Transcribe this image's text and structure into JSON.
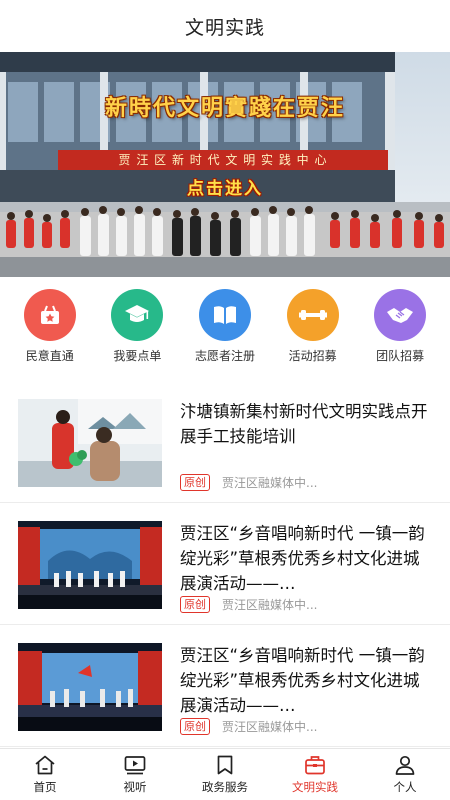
{
  "header": {
    "title": "文明实践"
  },
  "banner": {
    "headline": "新時代文明實踐在贾汪",
    "sign": "贾 汪 区 新 时 代 文 明 实 践 中 心",
    "cta": "点击进入"
  },
  "quick_nav": [
    {
      "label": "民意直通",
      "icon": "basket-star-icon",
      "color": "#f05a4f"
    },
    {
      "label": "我要点单",
      "icon": "graduation-cap-icon",
      "color": "#27b98a"
    },
    {
      "label": "志愿者注册",
      "icon": "open-book-icon",
      "color": "#3d8fe8"
    },
    {
      "label": "活动招募",
      "icon": "dumbbell-icon",
      "color": "#f4a12a"
    },
    {
      "label": "团队招募",
      "icon": "handshake-icon",
      "color": "#9a72e6"
    }
  ],
  "news": [
    {
      "title": "汴塘镇新集村新时代文明实践点开展手工技能培训",
      "tag": "原创",
      "source": "贾汪区融媒体中..."
    },
    {
      "title": "贾汪区“乡音唱响新时代 一镇一韵绽光彩”草根秀优秀乡村文化进城展演活动——…",
      "tag": "原创",
      "source": "贾汪区融媒体中..."
    },
    {
      "title": "贾汪区“乡音唱响新时代 一镇一韵绽光彩”草根秀优秀乡村文化进城展演活动——…",
      "tag": "原创",
      "source": "贾汪区融媒体中..."
    }
  ],
  "tabbar": [
    {
      "label": "首页",
      "icon": "home-icon",
      "active": false
    },
    {
      "label": "视听",
      "icon": "video-play-icon",
      "active": false
    },
    {
      "label": "政务服务",
      "icon": "bookmark-icon",
      "active": false
    },
    {
      "label": "文明实践",
      "icon": "briefcase-icon",
      "active": true
    },
    {
      "label": "个人",
      "icon": "person-icon",
      "active": false
    }
  ],
  "colors": {
    "accent": "#e0352b"
  }
}
